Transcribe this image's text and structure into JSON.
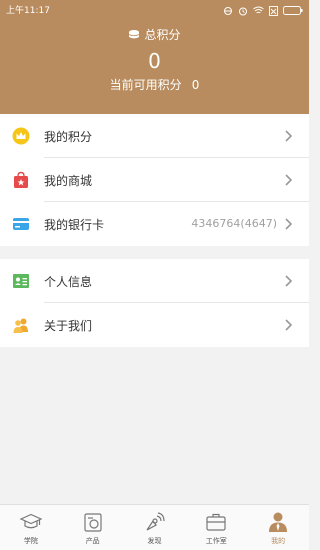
{
  "status_bar": {
    "time": "上午11:17"
  },
  "header": {
    "title": "总积分",
    "total_points": "0",
    "available_label": "当前可用积分",
    "available_value": "0"
  },
  "menu": {
    "points": {
      "label": "我的积分",
      "icon": "crown-icon"
    },
    "mall": {
      "label": "我的商城",
      "icon": "shopping-bag-icon"
    },
    "bank_card": {
      "label": "我的银行卡",
      "value": "4346764(4647)",
      "icon": "card-icon"
    },
    "profile": {
      "label": "个人信息",
      "icon": "id-card-icon"
    },
    "about": {
      "label": "关于我们",
      "icon": "people-icon"
    }
  },
  "tabs": [
    {
      "label": "学院",
      "icon": "graduation-cap-icon",
      "active": false
    },
    {
      "label": "产品",
      "icon": "product-icon",
      "active": false
    },
    {
      "label": "发现",
      "icon": "discover-icon",
      "active": false
    },
    {
      "label": "工作室",
      "icon": "briefcase-icon",
      "active": false
    },
    {
      "label": "我的",
      "icon": "person-icon",
      "active": true
    }
  ],
  "colors": {
    "header_bg": "#b88c5e",
    "accent": "#b88c5e",
    "page_bg": "#f2f2f2"
  }
}
